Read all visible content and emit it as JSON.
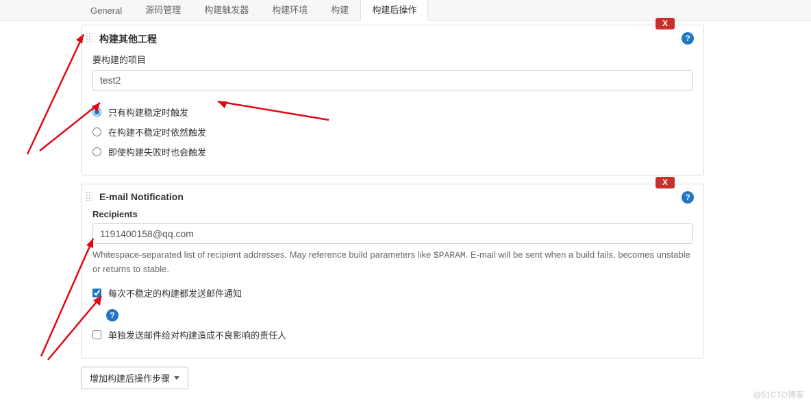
{
  "tabs": {
    "general": "General",
    "scm": "源码管理",
    "triggers": "构建触发器",
    "env": "构建环境",
    "build": "构建",
    "postbuild": "构建后操作"
  },
  "section1": {
    "title": "构建其他工程",
    "project_label": "要构建的项目",
    "project_value": "test2",
    "close": "X",
    "help": "?",
    "radio1": "只有构建稳定时触发",
    "radio2": "在构建不稳定时依然触发",
    "radio3": "即使构建失败时也会触发"
  },
  "section2": {
    "title": "E-mail Notification",
    "recipients_label": "Recipients",
    "recipients_value": "1191400158@qq.com",
    "close": "X",
    "help": "?",
    "hint_pre": "Whitespace-separated list of recipient addresses. May reference build parameters like ",
    "hint_code": "$PARAM",
    "hint_post": ". E-mail will be sent when a build fails, becomes unstable or returns to stable.",
    "check1": "每次不稳定的构建都发送邮件通知",
    "check2": "单独发送邮件给对构建造成不良影响的责任人",
    "help2": "?"
  },
  "footer": {
    "add_step": "增加构建后操作步骤"
  },
  "watermark": "@51CTO博客"
}
